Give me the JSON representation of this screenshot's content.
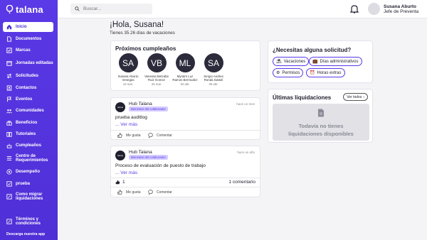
{
  "brand": {
    "name": "talana"
  },
  "sidebar": {
    "items": [
      {
        "label": "Inicio",
        "icon": "home-icon"
      },
      {
        "label": "Documentos",
        "icon": "document-icon"
      },
      {
        "label": "Marcas",
        "icon": "check-square-icon"
      },
      {
        "label": "Jornadas editadas",
        "icon": "calendar-icon"
      },
      {
        "label": "Solicitudes",
        "icon": "swap-icon"
      },
      {
        "label": "Contactos",
        "icon": "contacts-icon"
      },
      {
        "label": "Eventos",
        "icon": "flag-icon"
      },
      {
        "label": "Comunidades",
        "icon": "community-icon"
      },
      {
        "label": "Beneficios",
        "icon": "gift-icon"
      },
      {
        "label": "Tutoriales",
        "icon": "book-icon"
      },
      {
        "label": "Cumpleaños",
        "icon": "cake-icon"
      },
      {
        "label": "Centro de Requerimientos",
        "icon": "list-icon"
      },
      {
        "label": "Desempeño",
        "icon": "target-icon"
      },
      {
        "label": "prueba",
        "icon": "square-check-icon"
      },
      {
        "label": "Como migrar liquidaciones",
        "icon": "edit-icon"
      },
      {
        "label": "Términos y condiciones",
        "icon": "edit-icon"
      }
    ],
    "download": "Descarga nuestra app"
  },
  "topbar": {
    "search_placeholder": "Buscar...",
    "user_name": "Susana Aburto",
    "user_role": "Jefe de Preventa"
  },
  "greeting": "¡Hola, Susana!",
  "vacations": "Tienes 35.26 días de vacaciones",
  "birthdays": {
    "title": "Próximos cumpleaños",
    "people": [
      {
        "initials": "SA",
        "name": "Susana Aburto Venegas",
        "date": "24 mar."
      },
      {
        "initials": "VB",
        "name": "Vanessa Betzabe Ruiz Gomez",
        "date": "25 mar."
      },
      {
        "initials": "ML",
        "name": "Myriam Luz Ramos Bermudez",
        "date": "04 abr."
      },
      {
        "initials": "SA",
        "name": "Sergio Andres Ronda Dattoli",
        "date": "05 abr."
      }
    ]
  },
  "posts": [
    {
      "author": "Hub Talana",
      "tag": "Bienestar del colaborador",
      "time": "hace un mes",
      "body": "prueba auditlog",
      "more": "... Ver más",
      "like": "Me gusta",
      "comment": "Comentar",
      "likes": "",
      "comments": ""
    },
    {
      "author": "Hub Talana",
      "tag": "Bienestar del colaborador",
      "time": "hace un año",
      "body": "Proceso de evaluación de puesto de trabajo",
      "more": "... Ver más",
      "like": "Me gusta",
      "comment": "Comentar",
      "likes": "1",
      "comments": "1 comentario"
    }
  ],
  "requests": {
    "title": "¿Necesitas alguna solicitud?",
    "chips": [
      {
        "label": "Vacaciones",
        "icon": "beach-icon"
      },
      {
        "label": "Días administrativos",
        "icon": "briefcase-icon"
      },
      {
        "label": "Permisos",
        "icon": "permit-icon"
      },
      {
        "label": "Horas extras",
        "icon": "clock-icon"
      }
    ]
  },
  "payslips": {
    "title": "Últimas liquidaciones",
    "see_all": "Ver todos",
    "empty": "Todavía no tienes liquidaciones disponibles"
  },
  "colors": {
    "accent": "#5a39e6",
    "sidebar": "#4f2fd6"
  }
}
